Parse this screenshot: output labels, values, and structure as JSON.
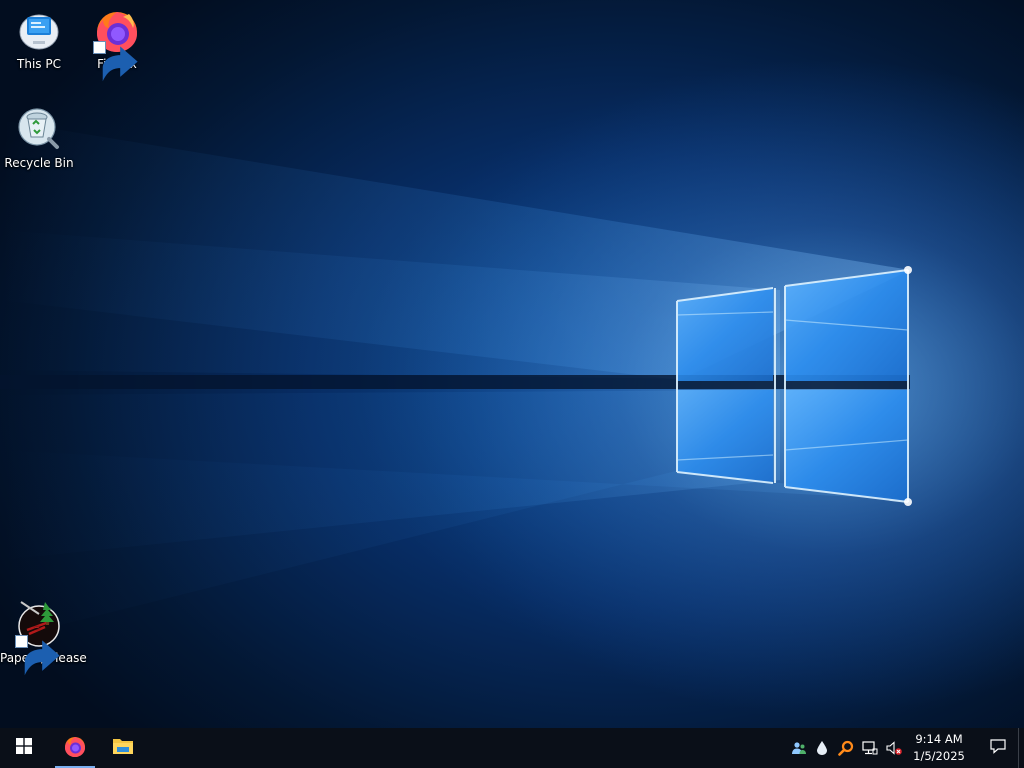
{
  "desktop": {
    "icons": [
      {
        "id": "this-pc",
        "label": "This PC",
        "icon": "this-pc-icon"
      },
      {
        "id": "firefox",
        "label": "Firefox",
        "icon": "firefox-icon",
        "shortcut": true
      },
      {
        "id": "recycle-bin",
        "label": "Recycle Bin",
        "icon": "recycle-bin-icon"
      },
      {
        "id": "papers-please",
        "label": "Papers, Please",
        "icon": "papers-please-icon",
        "shortcut": true
      }
    ]
  },
  "taskbar": {
    "start": {
      "icon": "windows-logo-icon"
    },
    "pinned": [
      {
        "id": "firefox",
        "icon": "firefox-icon",
        "active": true
      },
      {
        "id": "file-explorer",
        "icon": "folder-icon",
        "active": false
      }
    ],
    "tray": [
      {
        "id": "people",
        "icon": "people-icon"
      },
      {
        "id": "drop",
        "icon": "water-drop-icon"
      },
      {
        "id": "search",
        "icon": "magnifier-icon"
      },
      {
        "id": "network",
        "icon": "network-icon"
      },
      {
        "id": "volume",
        "icon": "volume-muted-icon"
      }
    ],
    "clock": {
      "time": "9:14 AM",
      "date": "1/5/2025"
    },
    "notifications": {
      "icon": "action-center-icon"
    }
  },
  "colors": {
    "taskbar_bg": "#0a0f18",
    "wallpaper_glow": "#3c96eb",
    "wallpaper_dark": "#020d1f"
  }
}
